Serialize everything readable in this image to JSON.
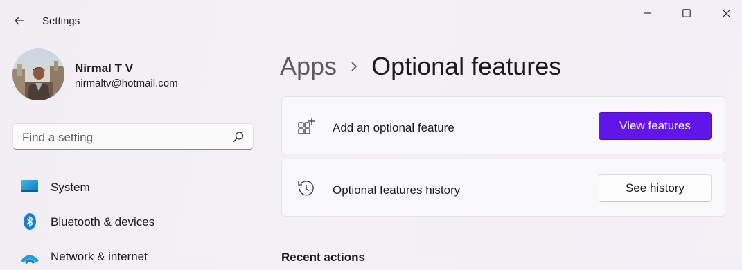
{
  "window": {
    "app_title": "Settings",
    "controls": {
      "minimize": "minimize-icon",
      "maximize": "maximize-icon",
      "close": "close-icon"
    }
  },
  "profile": {
    "name": "Nirmal T V",
    "email": "nirmaltv@hotmail.com"
  },
  "search": {
    "placeholder": "Find a setting",
    "icon": "search-icon"
  },
  "sidebar": {
    "items": [
      {
        "label": "System",
        "icon": "monitor-icon"
      },
      {
        "label": "Bluetooth & devices",
        "icon": "bluetooth-icon"
      },
      {
        "label": "Network & internet",
        "icon": "wifi-icon"
      }
    ]
  },
  "breadcrumb": {
    "parent": "Apps",
    "current": "Optional features"
  },
  "cards": [
    {
      "label": "Add an optional feature",
      "button": "View features",
      "icon": "add-feature-icon"
    },
    {
      "label": "Optional features history",
      "button": "See history",
      "icon": "history-icon"
    }
  ],
  "section": {
    "recent_actions": "Recent actions"
  },
  "colors": {
    "accent": "#6215e8",
    "background": "#f3eff5"
  }
}
